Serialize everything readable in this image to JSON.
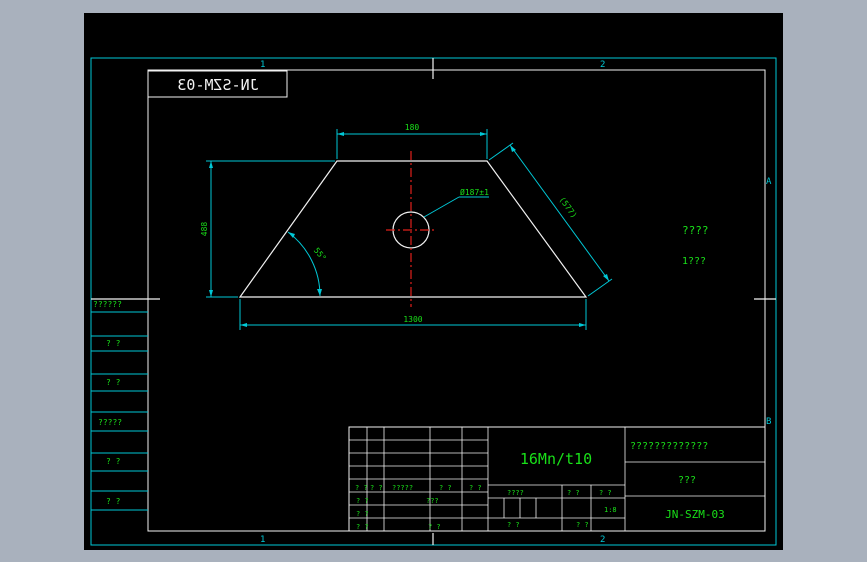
{
  "drawing": {
    "mirrored_title": "JN-SZM-03",
    "zone_cols": [
      "1",
      "2"
    ],
    "zone_rows": [
      "A",
      "B"
    ],
    "notes": [
      "????",
      "1???"
    ],
    "dimensions": {
      "top_width": "180",
      "bottom_width": "1300",
      "height": "488",
      "slant": "(577)",
      "angle": "55°",
      "hole": "Ø187±1"
    },
    "side_labels": [
      "??????",
      "?  ?",
      "?  ?",
      "?????",
      "?  ?",
      "?  ?"
    ]
  },
  "title_block": {
    "material": "16Mn/t10",
    "title": "?????????????",
    "subtitle": "???",
    "drawing_number": "JN-SZM-03",
    "scale": "1:8",
    "scale_label": "?   ?",
    "weight_label": "?   ?",
    "stage_label": "????",
    "qty_label": "?  ?",
    "wt_label": "?  ?",
    "sign_row": [
      "?  ?",
      "?  ?",
      "?????",
      "?  ?",
      "?  ?"
    ],
    "left_rows": [
      {
        "a": "?  ?",
        "b": "???"
      },
      {
        "a": "?  ?",
        "b": ""
      },
      {
        "a": "?  ?",
        "b": "?  ?"
      }
    ]
  }
}
